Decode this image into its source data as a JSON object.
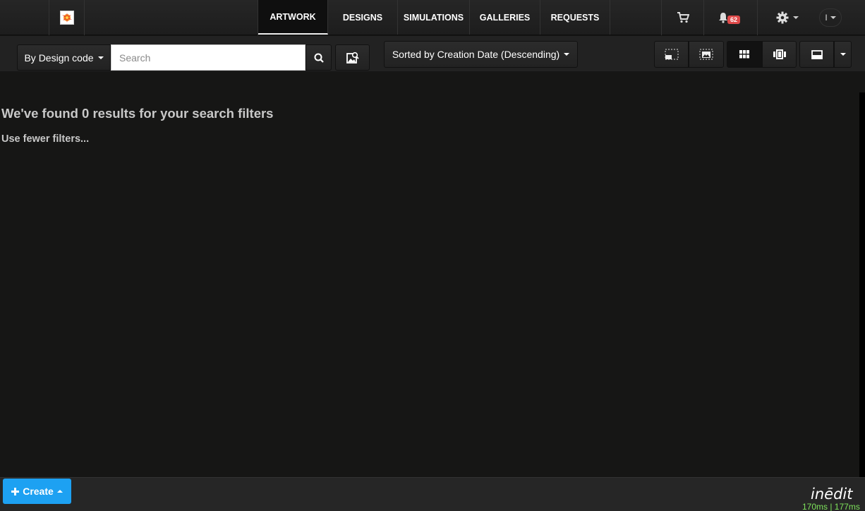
{
  "nav": {
    "tabs": [
      {
        "label": "ARTWORK",
        "active": true
      },
      {
        "label": "DESIGNS"
      },
      {
        "label": "SIMULATIONS"
      },
      {
        "label": "GALLERIES"
      },
      {
        "label": "REQUESTS"
      }
    ],
    "notifications_count": "62",
    "user_initial": "I"
  },
  "toolbar": {
    "search_mode_label": "By Design code",
    "search_placeholder": "Search",
    "sort_label": "Sorted by Creation Date (Descending)"
  },
  "results": {
    "title": "We've found 0 results for your search filters",
    "hint": "Use fewer filters..."
  },
  "footer": {
    "create_label": "Create",
    "brand": "inēdit",
    "timing": "170ms | 177ms"
  },
  "colors": {
    "accent": "#1da1f2",
    "badge": "#e04b4b",
    "timing": "#7ee35b",
    "background": "#161615"
  },
  "icons": [
    "logo",
    "cart-icon",
    "bell-icon",
    "gear-icon",
    "search-icon",
    "image-search-icon",
    "crop-icon",
    "image-frame-icon",
    "grid-icon",
    "carousel-icon",
    "card-icon",
    "chevron-down-icon",
    "plus-icon"
  ]
}
